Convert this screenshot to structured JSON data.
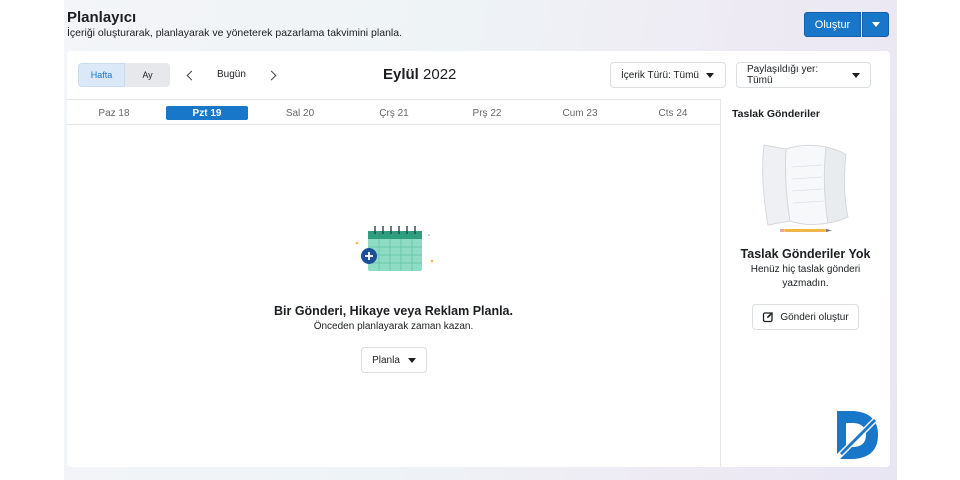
{
  "header": {
    "title": "Planlayıcı",
    "subtitle": "İçeriği oluşturarak, planlayarak ve yöneterek pazarlama takvimini planla."
  },
  "create_button": {
    "label": "Oluştur",
    "color": "#1877c9"
  },
  "view_toggle": {
    "week": "Hafta",
    "month": "Ay",
    "selected": "Hafta"
  },
  "nav": {
    "today": "Bugün",
    "month_name": "Eylül",
    "year": "2022"
  },
  "filters": {
    "content_type": "İçerik Türü: Tümü",
    "shared_on": "Paylaşıldığı yer: Tümü"
  },
  "days": [
    "Paz 18",
    "Pzt 19",
    "Sal 20",
    "Çrş 21",
    "Prş 22",
    "Cum 23",
    "Cts 24"
  ],
  "active_day": "Pzt 19",
  "empty_state": {
    "title": "Bir Gönderi, Hikaye veya Reklam Planla.",
    "subtitle": "Önceden planlayarak zaman kazan.",
    "button": "Planla"
  },
  "drafts": {
    "title": "Taslak Gönderiler",
    "empty_title": "Taslak Gönderiler Yok",
    "empty_subtitle": "Henüz hiç taslak gönderi yazmadın.",
    "button": "Gönderi oluştur"
  },
  "icons": {
    "calendar": "calendar-plus-icon",
    "edit": "edit-icon",
    "logo": "brand-logo-icon"
  }
}
